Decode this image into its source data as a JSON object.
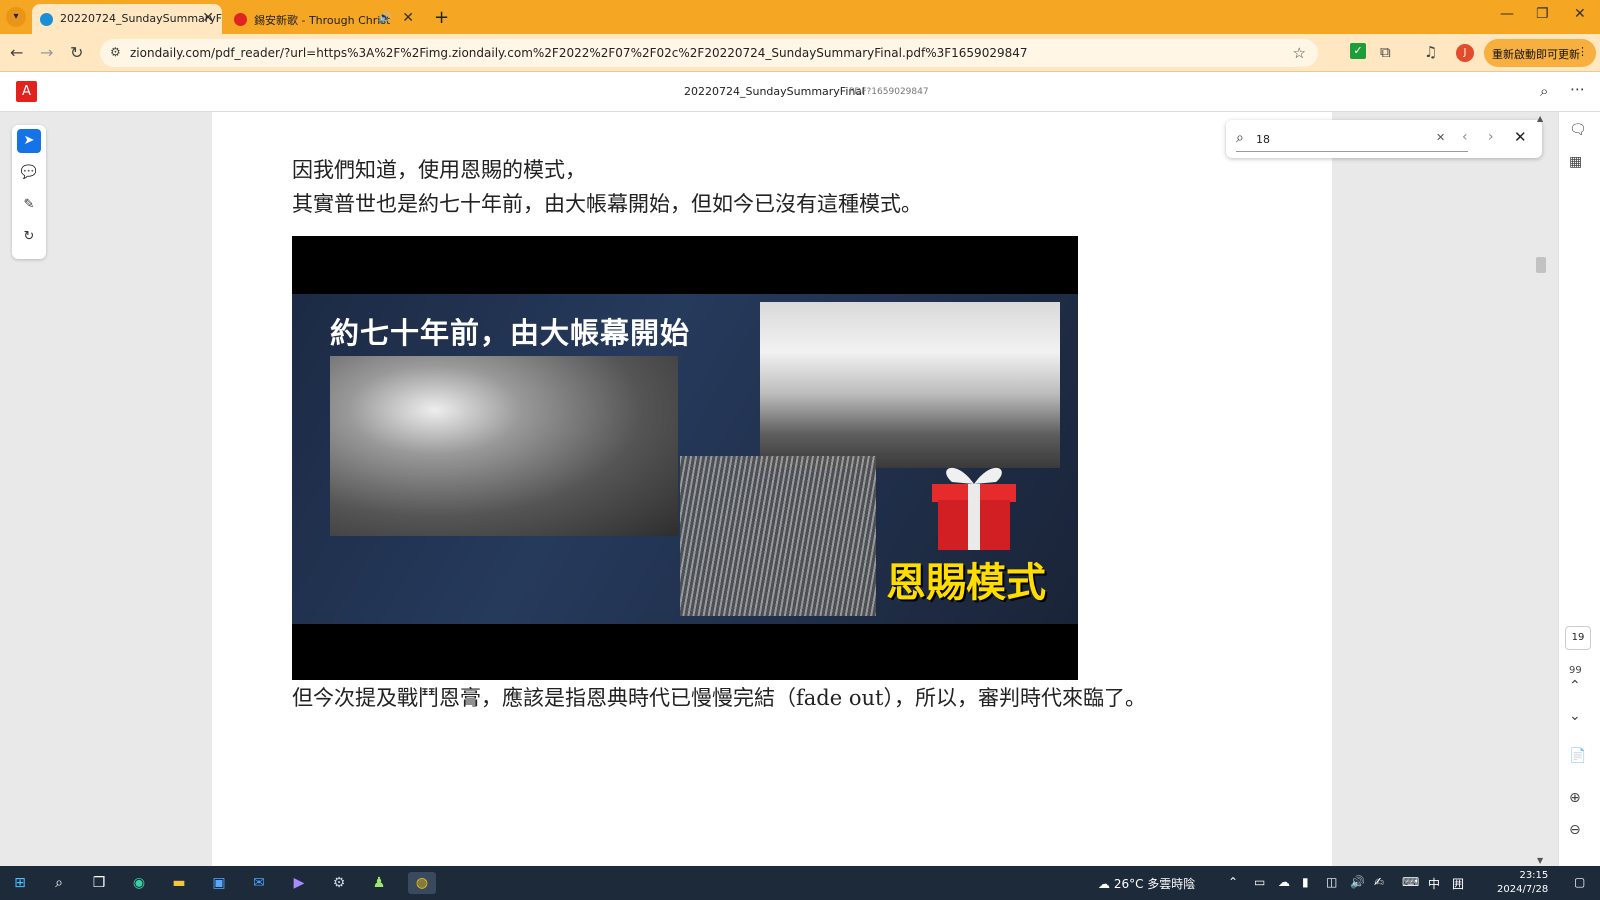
{
  "browser": {
    "tabs": [
      {
        "label": "20220724_SundaySummaryF",
        "active": true
      },
      {
        "label": "錫安新歌 - Through Christ",
        "active": false
      }
    ],
    "url": "ziondaily.com/pdf_reader/?url=https%3A%2F%2Fimg.ziondaily.com%2F2022%2F07%2F02c%2F20220724_SundaySummaryFinal.pdf%3F1659029847",
    "profile_initial": "J",
    "update_label": "重新啟動即可更新",
    "colors": {
      "tabbar": "#f5a623",
      "toolbar": "#ffe7c2"
    }
  },
  "viewer": {
    "title": "20220724_SundaySummaryFinal",
    "subtitle": "PDF?1659029847",
    "search_value": "18",
    "current_page": "19",
    "total_pages": "99"
  },
  "document": {
    "para1_line1": "因我們知道，使用恩賜的模式，",
    "para1_line2": "其實普世也是約七十年前，由大帳幕開始，但如今已沒有這種模式。",
    "figure_title": "約七十年前，由大帳幕開始",
    "figure_badge": "恩賜模式",
    "para2": "但今次提及戰鬥恩膏，應該是指恩典時代已慢慢完結（fade out），所以，審判時代來臨了。"
  },
  "taskbar": {
    "weather": "26°C 多雲時陰",
    "ime": "中",
    "time": "23:15",
    "date": "2024/7/28"
  }
}
